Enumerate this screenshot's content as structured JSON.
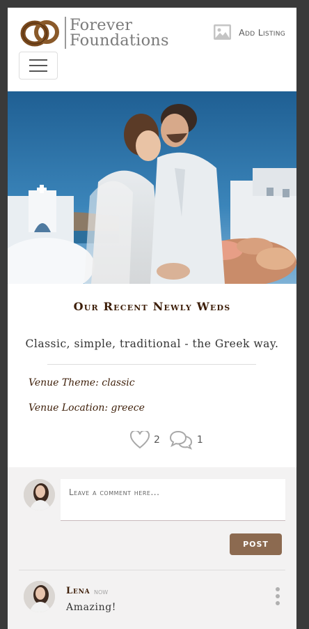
{
  "header": {
    "brand_line1": "Forever",
    "brand_line2": "Foundations",
    "add_listing_label": "Add Listing"
  },
  "post": {
    "title": "Our Recent Newly Weds",
    "caption": "Classic, simple, traditional - the Greek way.",
    "venue_theme": "Venue Theme: classic",
    "venue_location": "Venue Location: greece",
    "likes": "2",
    "comments": "1"
  },
  "comment_form": {
    "placeholder": "Leave a comment here...",
    "post_label": "POST"
  },
  "comments": [
    {
      "author": "Lena",
      "time": "now",
      "text": "Amazing!"
    }
  ],
  "colors": {
    "brand_brown": "#8c6a50",
    "title_brown": "#3d1e08",
    "comments_bg": "#f3f2f2"
  },
  "icons": {
    "logo": "wedding-rings-logo",
    "add_listing": "image-icon",
    "menu": "hamburger-icon",
    "like": "heart-icon",
    "comment": "comment-bubbles-icon",
    "more": "kebab-icon"
  }
}
